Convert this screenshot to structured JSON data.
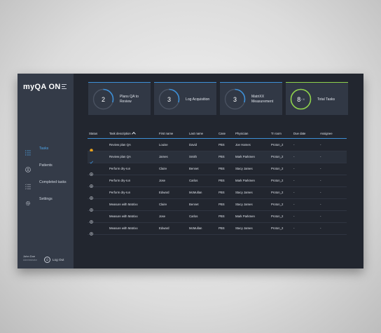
{
  "app": {
    "brand": "myQA ON",
    "menu_icon": "hamburger-menu-icon"
  },
  "sidebar": {
    "items": [
      {
        "label": "Tasks",
        "icon": "list-icon",
        "active": true
      },
      {
        "label": "Patients",
        "icon": "patients-icon",
        "active": false
      },
      {
        "label": "Completed tasks",
        "icon": "checklist-icon",
        "active": false
      },
      {
        "label": "Settings",
        "icon": "gear-icon",
        "active": false
      }
    ],
    "user": {
      "name": "John Doe",
      "role": "Administrator"
    },
    "logout_label": "Log Out"
  },
  "cards": [
    {
      "count": "2",
      "label": "Plans QA to Review",
      "progress": 0.3,
      "color": "#3d8fd6"
    },
    {
      "count": "3",
      "label": "Log Acquisition",
      "progress": 0.3,
      "color": "#3d8fd6"
    },
    {
      "count": "3",
      "label": "MatriXX Measurement",
      "progress": 0.3,
      "color": "#3d8fd6"
    },
    {
      "count": "8",
      "total": "/ 8",
      "label": "Total Tasks",
      "progress": 1.0,
      "color": "#8ed24b"
    }
  ],
  "table": {
    "headers": [
      "Status",
      "Task description",
      "First name",
      "Last name",
      "Case",
      "Physician",
      "Tr room",
      "Due date",
      "Assignee"
    ],
    "rows": [
      {
        "status": "pending",
        "task": "Review plan QA",
        "first": "Louise",
        "last": "David",
        "case": "PBS",
        "physician": "Joe Hames",
        "room": "Proton_2",
        "due": "-",
        "assignee": "-"
      },
      {
        "status": "done",
        "task": "Review plan QA",
        "first": "James",
        "last": "Smith",
        "case": "PBS",
        "physician": "Mark Parkmen",
        "room": "Proton_2",
        "due": "-",
        "assignee": "-"
      },
      {
        "status": "queued",
        "task": "Perform dry-run",
        "first": "Claire",
        "last": "Bennet",
        "case": "PBS",
        "physician": "Stacy James",
        "room": "Proton_2",
        "due": "-",
        "assignee": "-"
      },
      {
        "status": "queued",
        "task": "Perform dry-run",
        "first": "Jose",
        "last": "Carlos",
        "case": "PBS",
        "physician": "Mark Parkmen",
        "room": "Proton_2",
        "due": "-",
        "assignee": "-"
      },
      {
        "status": "queued",
        "task": "Perform dry-run",
        "first": "Edward",
        "last": "McMullan",
        "case": "PBS",
        "physician": "Stacy James",
        "room": "Proton_2",
        "due": "-",
        "assignee": "-"
      },
      {
        "status": "queued",
        "task": "Measure with Matrixx",
        "first": "Claire",
        "last": "Bennet",
        "case": "PBS",
        "physician": "Stacy James",
        "room": "Proton_2",
        "due": "-",
        "assignee": "-"
      },
      {
        "status": "queued",
        "task": "Measure with Matrixx",
        "first": "Jose",
        "last": "Carlos",
        "case": "PBS",
        "physician": "Mark Parkmen",
        "room": "Proton_2",
        "due": "-",
        "assignee": "-"
      },
      {
        "status": "queued",
        "task": "Measure with Matrixx",
        "first": "Edward",
        "last": "McMullan",
        "case": "PBS",
        "physician": "Stacy James",
        "room": "Proton_2",
        "due": "-",
        "assignee": "-"
      }
    ]
  },
  "colors": {
    "accent": "#3d8fd6",
    "complete": "#8ed24b",
    "pending": "#e8a21e"
  }
}
